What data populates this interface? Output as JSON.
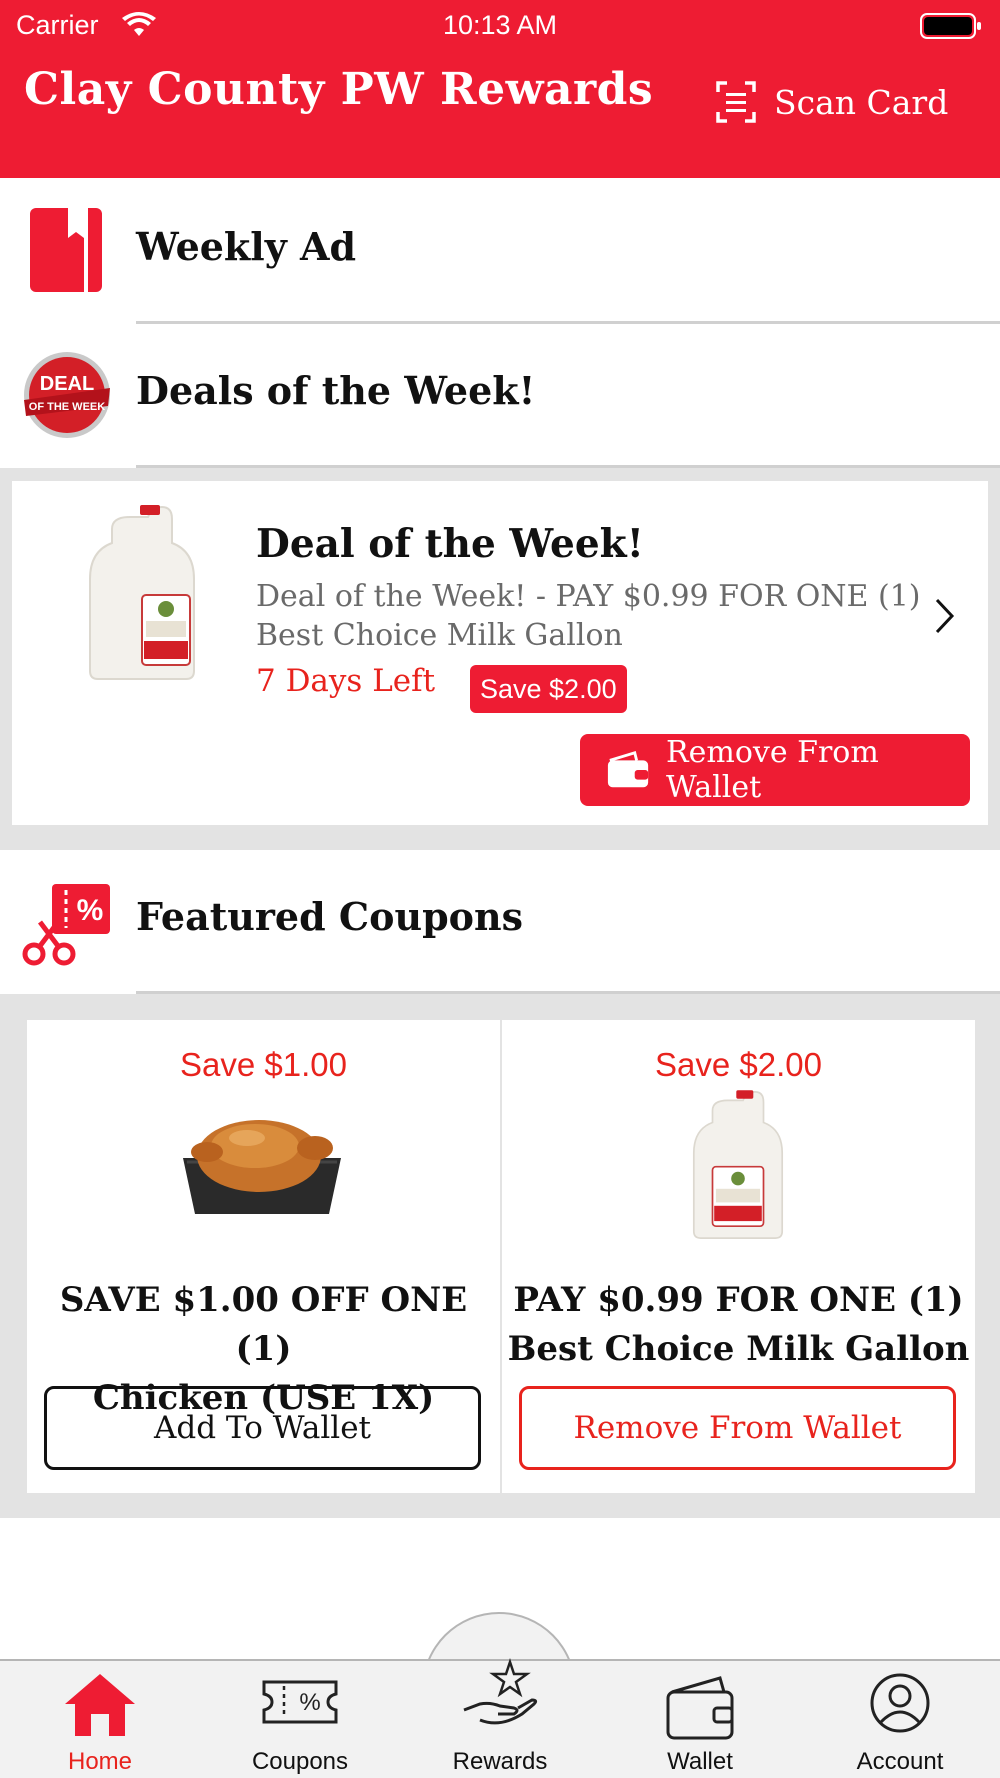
{
  "status_bar": {
    "carrier": "Carrier",
    "time": "10:13 AM"
  },
  "header": {
    "title": "Clay County PW Rewards",
    "scan_label": "Scan Card"
  },
  "sections": {
    "weekly_ad": "Weekly Ad",
    "deals_of_week": "Deals of the Week!",
    "featured_coupons": "Featured Coupons"
  },
  "deal": {
    "title": "Deal of the Week!",
    "description": "Deal of the Week! - PAY $0.99 FOR ONE (1) Best Choice Milk Gallon",
    "days_left": "7 Days Left",
    "save_badge": "Save $2.00",
    "action_label": "Remove From Wallet"
  },
  "coupons": [
    {
      "save": "Save $1.00",
      "line1": "SAVE $1.00 OFF ONE (1)",
      "line2": "Chicken (USE 1X)",
      "action": "Add To Wallet",
      "image": "rotisserie-chicken"
    },
    {
      "save": "Save $2.00",
      "line1": "PAY $0.99 FOR ONE (1)",
      "line2": "Best Choice Milk Gallon",
      "action": "Remove From Wallet",
      "image": "milk-gallon"
    }
  ],
  "tabs": [
    {
      "label": "Home",
      "icon": "home-icon",
      "active": true
    },
    {
      "label": "Coupons",
      "icon": "coupon-icon",
      "active": false
    },
    {
      "label": "Rewards",
      "icon": "rewards-icon",
      "active": false
    },
    {
      "label": "Wallet",
      "icon": "wallet-icon",
      "active": false
    },
    {
      "label": "Account",
      "icon": "account-icon",
      "active": false
    }
  ],
  "colors": {
    "brand_red": "#ee1c33",
    "accent_red": "#e8231d",
    "separator_gray": "#e3e3e3"
  }
}
